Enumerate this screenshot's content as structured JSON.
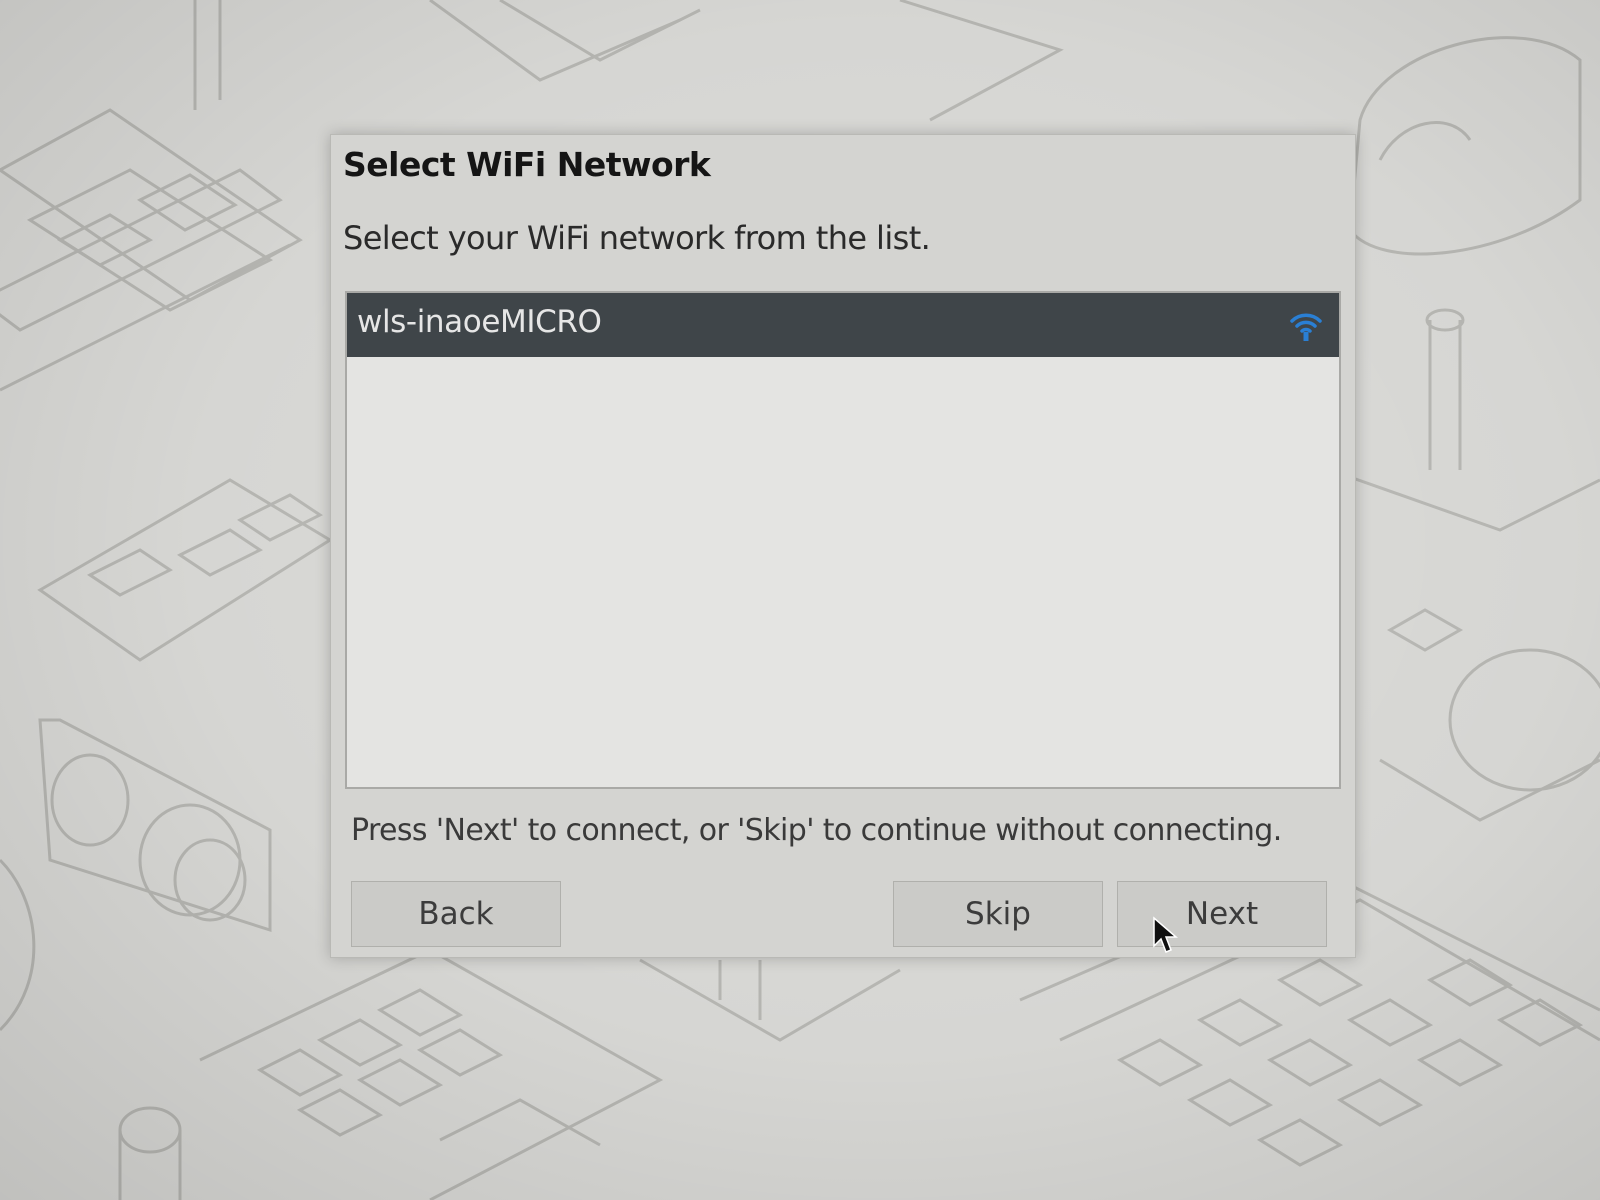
{
  "dialog": {
    "title": "Select WiFi Network",
    "subtitle": "Select your WiFi network from the list.",
    "networks": [
      {
        "ssid": "wls-inaoeMICRO",
        "icon": "wifi-signal-icon",
        "selected": true
      }
    ],
    "hint": "Press 'Next' to connect, or 'Skip' to continue without connecting.",
    "buttons": {
      "back": "Back",
      "skip": "Skip",
      "next": "Next"
    }
  },
  "colors": {
    "selection": "#3f4549",
    "wifi_icon": "#2a7fd4",
    "dialog_bg": "#d4d4d1"
  }
}
